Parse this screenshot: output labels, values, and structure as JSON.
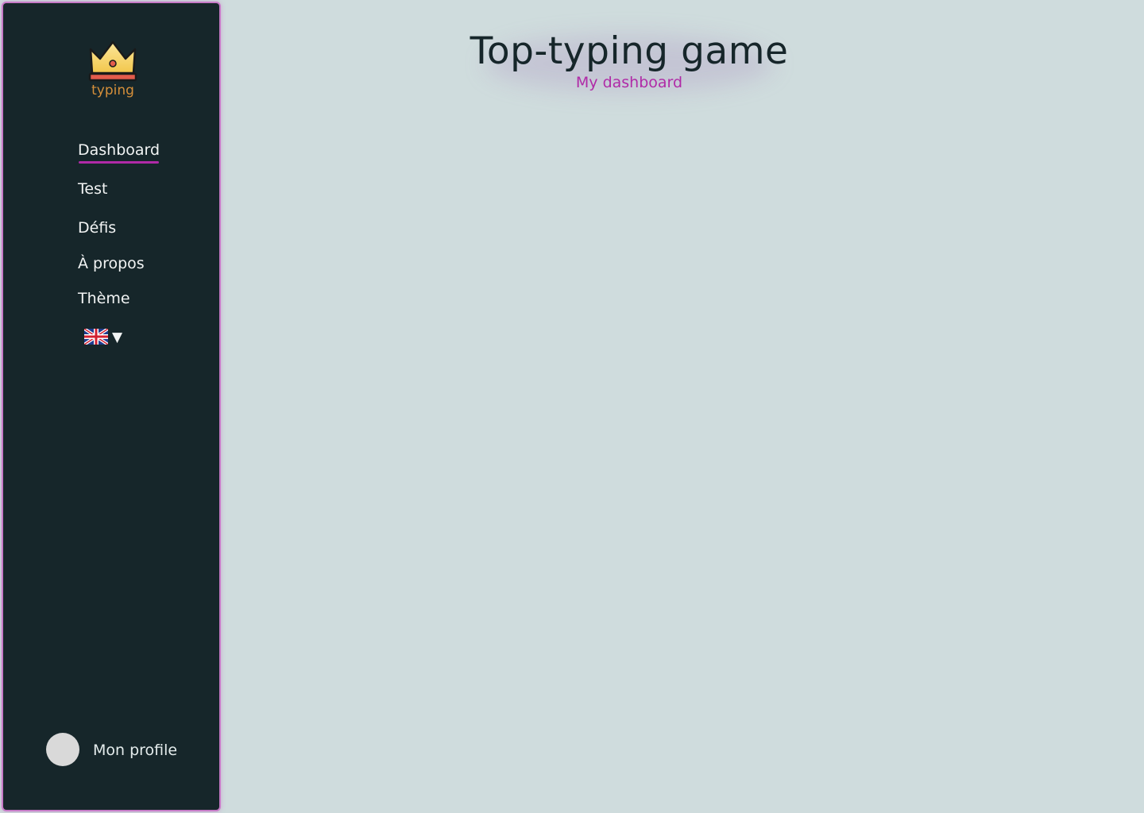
{
  "brand": {
    "logo_text": "typing"
  },
  "nav": {
    "items": [
      {
        "label": "Dashboard",
        "active": true
      },
      {
        "label": "Test",
        "active": false
      },
      {
        "label": "Défis",
        "active": false
      },
      {
        "label": "À propos",
        "active": false
      },
      {
        "label": "Thème",
        "active": false
      }
    ]
  },
  "language": {
    "selected": "English",
    "flag_icon": "uk-flag-icon",
    "caret": "▼"
  },
  "profile": {
    "label": "Mon profile"
  },
  "header": {
    "title": "Top-typing game",
    "subtitle": "My dashboard"
  },
  "colors": {
    "sidebar_bg": "#16262a",
    "page_bg": "#cfdcdd",
    "accent": "#b02aa7",
    "logo_text": "#d58f3a"
  }
}
